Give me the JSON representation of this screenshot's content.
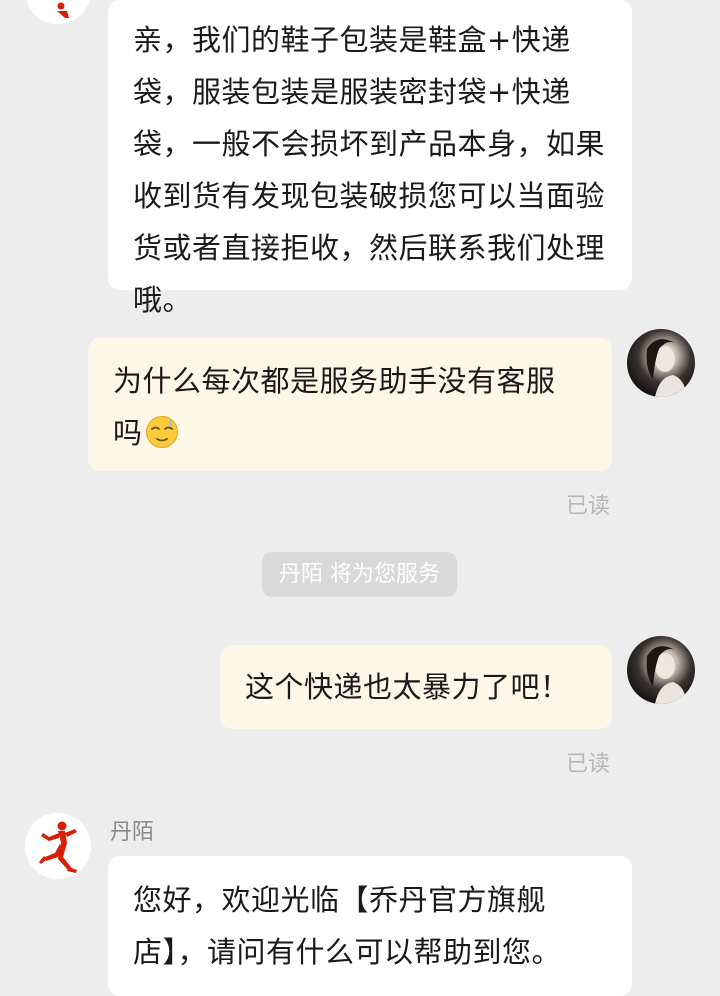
{
  "colors": {
    "background": "#ededed",
    "incoming_bubble": "#ffffff",
    "outgoing_bubble": "#fdf7e7",
    "brand_red": "#d81e06"
  },
  "messages": {
    "shop_reply_1": "亲，我们的鞋子包装是鞋盒+快递袋，服装包装是服装密封袋+快递袋，一般不会损坏到产品本身，如果收到货有发现包装破损您可以当面验货或者直接拒收，然后联系我们处理哦。",
    "user_question": "为什么每次都是服务助手没有客服吗",
    "user_question_emoji": "relieved-face-emoji",
    "user_read_1": "已读",
    "system_notice": "丹陌 将为您服务",
    "user_complaint": "这个快递也太暴力了吧！",
    "user_read_2": "已读",
    "agent_name": "丹陌",
    "agent_greeting": "您好，欢迎光临【乔丹官方旗舰店】，请问有什么可以帮助到您。"
  },
  "icons": {
    "shop_avatar": "jordan-jumpman-logo-icon",
    "user_avatar": "user-portrait-avatar"
  }
}
